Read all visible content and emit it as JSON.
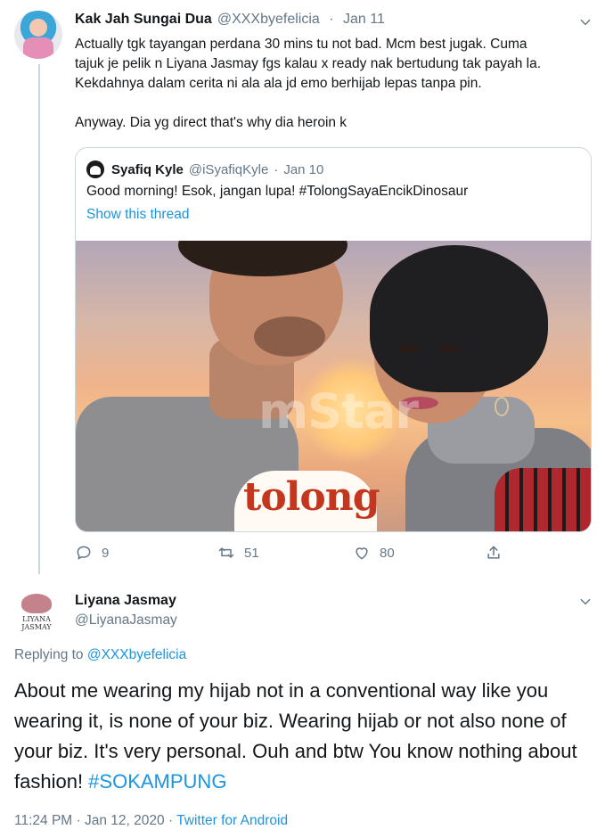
{
  "tweet1": {
    "author_name": "Kak Jah Sungai Dua",
    "author_handle": "@XXXbyefelicia",
    "separator": "·",
    "date": "Jan 11",
    "text_p1": "Actually tgk tayangan perdana 30 mins tu not bad. Mcm best jugak. Cuma\ntajuk je pelik n Liyana Jasmay fgs kalau x ready nak bertudung tak payah la.\nKekdahnya dalam cerita ni ala ala jd emo berhijab lepas tanpa pin.",
    "text_p2": "Anyway. Dia yg direct that's why dia heroin k",
    "quoted": {
      "author_name": "Syafiq Kyle",
      "author_handle": "@iSyafiqKyle",
      "separator": "·",
      "date": "Jan 10",
      "text": "Good morning! Esok, jangan lupa! #TolongSayaEncikDinosaur",
      "show_thread": "Show this thread",
      "image_watermark": "mStar",
      "image_logo_text": "tolong"
    },
    "actions": {
      "replies": "9",
      "retweets": "51",
      "likes": "80"
    }
  },
  "tweet2": {
    "author_name": "Liyana Jasmay",
    "author_handle": "@LiyanaJasmay",
    "avatar_brand": "LIYANA\nJASMAY",
    "replying_prefix": "Replying to",
    "replying_to": "@XXXbyefelicia",
    "text_main": "About me wearing my hijab not in a conventional way like you wearing it, is none of your biz. Wearing hijab or not also none of your biz. It's very personal. Ouh and btw You know nothing about fashion! ",
    "hashtag": "#SOKAMPUNG",
    "time": "11:24 PM",
    "separator1": "·",
    "date": "Jan 12, 2020",
    "separator2": "·",
    "source": "Twitter for Android"
  },
  "colors": {
    "text_primary": "#14171a",
    "text_secondary": "#657786",
    "link": "#1b95e0",
    "border": "#ccd6dd"
  },
  "icons": [
    "chevron-down-icon",
    "reply-icon",
    "retweet-icon",
    "like-icon",
    "share-icon"
  ]
}
